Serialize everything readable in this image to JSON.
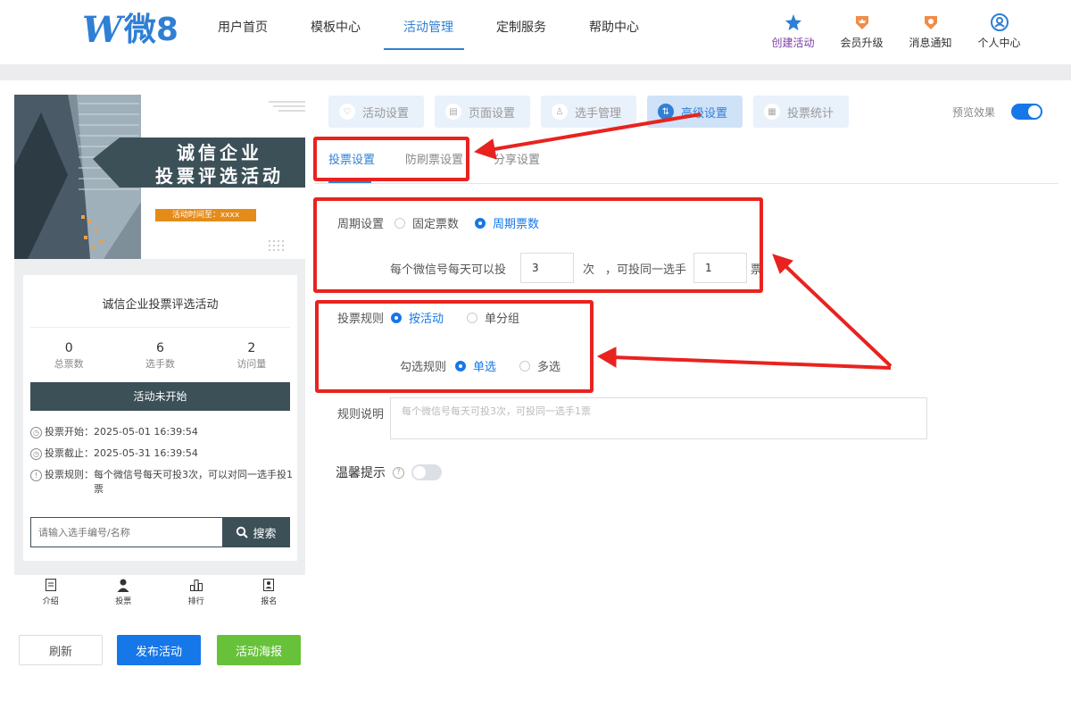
{
  "header": {
    "logo_w": "W",
    "logo_text": "微8",
    "nav": [
      "用户首页",
      "模板中心",
      "活动管理",
      "定制服务",
      "帮助中心"
    ],
    "tools": [
      "创建活动",
      "会员升级",
      "消息通知",
      "个人中心"
    ]
  },
  "preview": {
    "banner_title_1": "诚信企业",
    "banner_title_2": "投票评选活动",
    "banner_time": "活动时间至：xxxx",
    "card_title": "诚信企业投票评选活动",
    "stats": [
      {
        "num": "0",
        "label": "总票数"
      },
      {
        "num": "6",
        "label": "选手数"
      },
      {
        "num": "2",
        "label": "访问量"
      }
    ],
    "status": "活动未开始",
    "vote_start_label": "投票开始：",
    "vote_start": "2025-05-01 16:39:54",
    "vote_end_label": "投票截止：",
    "vote_end": "2025-05-31 16:39:54",
    "vote_rule_label": "投票规则：",
    "vote_rule": "每个微信号每天可投3次，可以对同一选手投1票",
    "search_placeholder": "请输入选手编号/名称",
    "search_button": "搜索",
    "tabs": [
      "介绍",
      "投票",
      "排行",
      "报名"
    ]
  },
  "buttons": {
    "refresh": "刷新",
    "publish": "发布活动",
    "poster": "活动海报"
  },
  "steps": [
    "活动设置",
    "页面设置",
    "选手管理",
    "高级设置",
    "投票统计"
  ],
  "preview_toggle_label": "预览效果",
  "subtabs": [
    "投票设置",
    "防刷票设置",
    "分享设置"
  ],
  "form": {
    "period_label": "周期设置",
    "period_options": [
      "固定票数",
      "周期票数"
    ],
    "daily_text_1": "每个微信号每天可以投",
    "daily_value": "3",
    "daily_text_2": "次",
    "daily_text_3": "，可投同一选手",
    "same_value": "1",
    "daily_text_4": "票",
    "rule_label": "投票规则",
    "rule_options": [
      "按活动",
      "单分组"
    ],
    "select_label": "勾选规则",
    "select_options": [
      "单选",
      "多选"
    ],
    "desc_label": "规则说明",
    "desc_text": "每个微信号每天可投3次，可投同一选手1票",
    "tip_label": "温馨提示"
  },
  "colors": {
    "accent": "#1677e8",
    "annotation": "#e8231f"
  }
}
